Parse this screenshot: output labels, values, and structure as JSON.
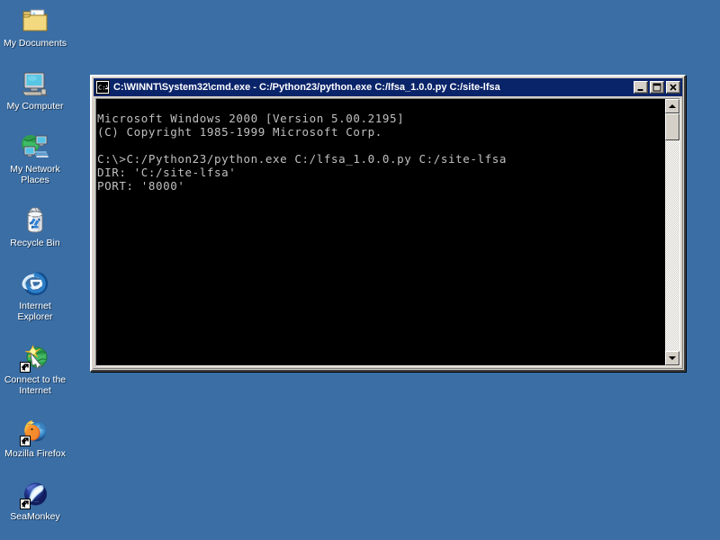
{
  "desktop": {
    "background_color": "#3a6ea5",
    "icons": [
      {
        "id": "my-documents",
        "label": "My Documents",
        "icon": "folder-document-icon",
        "shortcut": false
      },
      {
        "id": "my-computer",
        "label": "My Computer",
        "icon": "computer-icon",
        "shortcut": false
      },
      {
        "id": "my-network-places",
        "label": "My Network Places",
        "icon": "network-places-icon",
        "shortcut": false
      },
      {
        "id": "recycle-bin",
        "label": "Recycle Bin",
        "icon": "recycle-bin-icon",
        "shortcut": false
      },
      {
        "id": "internet-explorer",
        "label": "Internet Explorer",
        "icon": "internet-explorer-icon",
        "shortcut": false
      },
      {
        "id": "connect-to-internet",
        "label": "Connect to the Internet",
        "icon": "connect-globe-icon",
        "shortcut": true
      },
      {
        "id": "mozilla-firefox",
        "label": "Mozilla Firefox",
        "icon": "firefox-icon",
        "shortcut": true
      },
      {
        "id": "seamonkey",
        "label": "SeaMonkey",
        "icon": "seamonkey-icon",
        "shortcut": true
      }
    ]
  },
  "console_window": {
    "title": "C:\\WINNT\\System32\\cmd.exe - C:/Python23/python.exe C:/lfsa_1.0.0.py C:/site-lfsa",
    "titlebar_icon": "cmd-console-icon",
    "titlebar_color": "#0a246a",
    "buttons": {
      "minimize": {
        "name": "minimize-button",
        "glyph": "_"
      },
      "maximize": {
        "name": "maximize-button",
        "glyph": "□"
      },
      "close": {
        "name": "close-button",
        "glyph": "✕"
      }
    },
    "text_color": "#c0c0c0",
    "background_color": "#000000",
    "output": "Microsoft Windows 2000 [Version 5.00.2195]\n(C) Copyright 1985-1999 Microsoft Corp.\n\nC:\\>C:/Python23/python.exe C:/lfsa_1.0.0.py C:/site-lfsa\nDIR: 'C:/site-lfsa'\nPORT: '8000'",
    "scrollbar": {
      "up_arrow": "scroll-up-arrow-icon",
      "down_arrow": "scroll-down-arrow-icon",
      "thumb": "scrollbar-thumb"
    }
  }
}
